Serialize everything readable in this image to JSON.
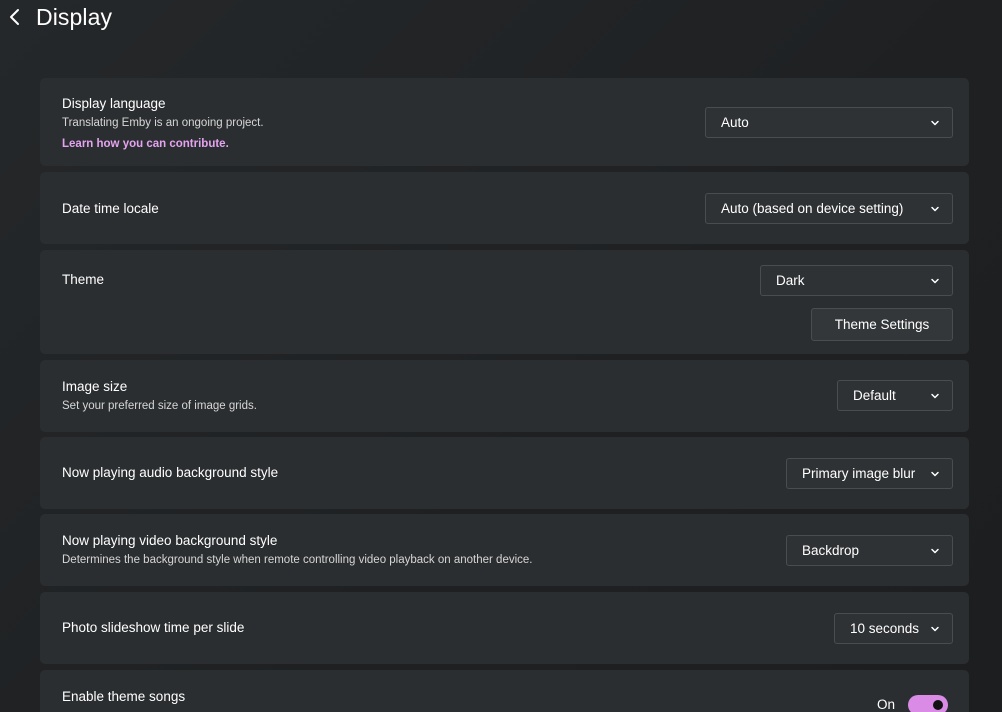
{
  "header": {
    "title": "Display"
  },
  "settings": {
    "display_language": {
      "label": "Display language",
      "description": "Translating Emby is an ongoing project.",
      "link": "Learn how you can contribute.",
      "value": "Auto"
    },
    "date_time_locale": {
      "label": "Date time locale",
      "value": "Auto (based on device setting)"
    },
    "theme": {
      "label": "Theme",
      "value": "Dark",
      "settings_button": "Theme Settings"
    },
    "image_size": {
      "label": "Image size",
      "description": "Set your preferred size of image grids.",
      "value": "Default"
    },
    "audio_background": {
      "label": "Now playing audio background style",
      "value": "Primary image blur"
    },
    "video_background": {
      "label": "Now playing video background style",
      "description": "Determines the background style when remote controlling video playback on another device.",
      "value": "Backdrop"
    },
    "slideshow_time": {
      "label": "Photo slideshow time per slide",
      "value": "10 seconds"
    },
    "theme_songs": {
      "label": "Enable theme songs",
      "toggle_text": "On",
      "enabled": true
    }
  },
  "colors": {
    "accent": "#d98be6",
    "link": "#e4a3f0",
    "card_background": "#2b2e30",
    "page_background": "#202223"
  },
  "icons": {
    "back": "chevron-left-icon",
    "dropdown": "chevron-down-icon"
  }
}
